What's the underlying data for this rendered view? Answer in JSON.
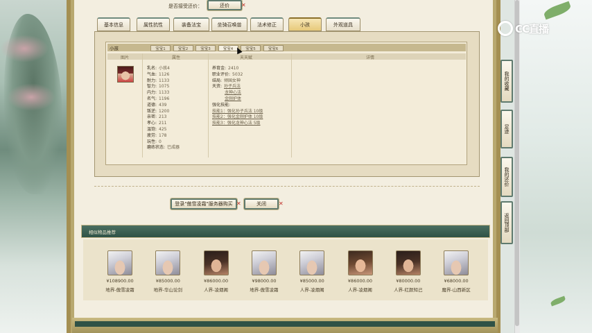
{
  "repay": {
    "label": "是否接受还价：",
    "button": "还价"
  },
  "tabs": [
    "基本信息",
    "属性抗性",
    "装备法宝",
    "坐骑召唤兽",
    "法术修正",
    "小孩",
    "外观道具"
  ],
  "child_panel": {
    "title": "小孩",
    "subtabs": [
      "宝宝1",
      "宝宝2",
      "宝宝3",
      "宝宝4",
      "宝宝5",
      "宝宝6"
    ],
    "columns": {
      "image": "图片",
      "attributes": "属性",
      "innate": "天天赋",
      "notes": "详情"
    },
    "attrs": [
      {
        "k": "乳名:",
        "v": "小孩4"
      },
      {
        "k": "气血:",
        "v": "1126"
      },
      {
        "k": "耐力:",
        "v": "1133"
      },
      {
        "k": "智力:",
        "v": "1075"
      },
      {
        "k": "内力:",
        "v": "1133"
      },
      {
        "k": "名气:",
        "v": "1196"
      },
      {
        "k": "道德:",
        "v": "439"
      },
      {
        "k": "叛逆:",
        "v": "1200"
      },
      {
        "k": "亲密:",
        "v": "213"
      },
      {
        "k": "孝心:",
        "v": "211"
      },
      {
        "k": "温饱:",
        "v": "425"
      },
      {
        "k": "疲劳:",
        "v": "178"
      },
      {
        "k": "玩性:",
        "v": "0"
      },
      {
        "k": "磨练状态:",
        "v": "已成器"
      }
    ],
    "growth": [
      {
        "k": "养育金:",
        "v": "2410"
      },
      {
        "k": "职业评价:",
        "v": "5032"
      },
      {
        "k": "结局:",
        "v": "倾国女神"
      },
      {
        "k": "天资:",
        "v": "孙子兵法"
      },
      {
        "k": "",
        "v": "龙神心法"
      },
      {
        "k": "",
        "v": "金刚护体"
      },
      {
        "k": "强化技能:",
        "v": ""
      },
      {
        "k": "",
        "v": "技能1：强化孙子兵法 10级"
      },
      {
        "k": "",
        "v": "技能2：强化金刚护体 10级"
      },
      {
        "k": "",
        "v": "技能3：强化龙神心法 5级"
      }
    ]
  },
  "actions": {
    "login": "登录\"傲雪凌霜\"服务器购买",
    "close": "关闭"
  },
  "similar": {
    "title": "相似物品推荐",
    "items": [
      {
        "price": "¥108900.00",
        "server": "地界-傲雪凌霜",
        "style": "silver"
      },
      {
        "price": "¥85000.00",
        "server": "地界-华山论剑",
        "style": "silver"
      },
      {
        "price": "¥86000.00",
        "server": "人界-凌烟阁",
        "style": "dark"
      },
      {
        "price": "¥98000.00",
        "server": "地界-傲雪凌霜",
        "style": "silver"
      },
      {
        "price": "¥85000.00",
        "server": "人界-凌烟阁",
        "style": "silver"
      },
      {
        "price": "¥86000.00",
        "server": "人界-凌烟阁",
        "style": "brown"
      },
      {
        "price": "¥80000.00",
        "server": "人界-红颜知己",
        "style": "dark"
      },
      {
        "price": "¥68000.00",
        "server": "魔界-山西新区",
        "style": "silver"
      }
    ]
  },
  "side_nav": [
    "我的收藏",
    "足迹",
    "我的还价",
    "返回顶部"
  ],
  "logo": {
    "text": "CC直播"
  }
}
